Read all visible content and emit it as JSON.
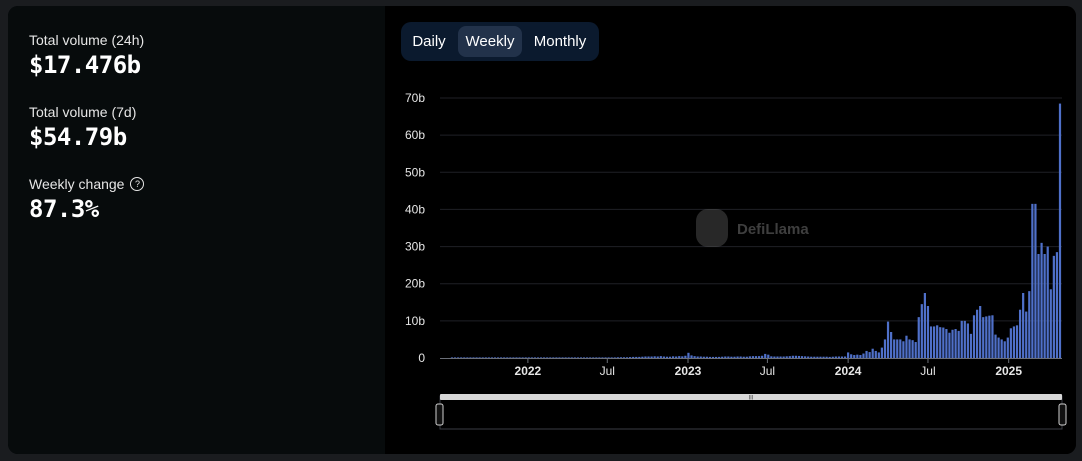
{
  "stats": {
    "total_24h": {
      "label": "Total volume (24h)",
      "value": "$17.476b"
    },
    "total_7d": {
      "label": "Total volume (7d)",
      "value": "$54.79b"
    },
    "weekly_change": {
      "label": "Weekly change",
      "value": "87.3%",
      "icon": "question-circle-icon"
    }
  },
  "tabs": [
    {
      "label": "Daily",
      "active": false
    },
    {
      "label": "Weekly",
      "active": true
    },
    {
      "label": "Monthly",
      "active": false
    }
  ],
  "watermark": "DefiLlama",
  "colors": {
    "bar": "#4f70c9",
    "grid": "#1f2126",
    "panel_left": "#070b0c",
    "tab_bg": "#0b1a2e",
    "tab_active": "#22324a"
  },
  "chart_data": {
    "type": "bar",
    "title": "",
    "xlabel": "",
    "ylabel": "",
    "ylim": [
      0,
      70
    ],
    "y_ticks": [
      "0",
      "10b",
      "20b",
      "30b",
      "40b",
      "50b",
      "60b",
      "70b"
    ],
    "y_unit": "billion USD",
    "x_tick_labels": [
      "2022",
      "Jul",
      "2023",
      "Jul",
      "2024",
      "Jul",
      "2025"
    ],
    "x_tick_positions": [
      "2022-01",
      "2022-07",
      "2023-01",
      "2023-07",
      "2024-01",
      "2024-07",
      "2025-01"
    ],
    "x_range": [
      "2021-07",
      "2025-01"
    ],
    "week_start": "2021-07-12",
    "series": [
      {
        "values": [
          0.05,
          0.05,
          0.05,
          0.05,
          0.05,
          0.05,
          0.05,
          0.05,
          0.05,
          0.05,
          0.05,
          0.05,
          0.05,
          0.05,
          0.05,
          0.05,
          0.05,
          0.05,
          0.05,
          0.05,
          0.05,
          0.05,
          0.05,
          0.05,
          0.05,
          0.05,
          0.05,
          0.05,
          0.05,
          0.05,
          0.05,
          0.05,
          0.05,
          0.05,
          0.05,
          0.05,
          0.05,
          0.05,
          0.05,
          0.05,
          0.05,
          0.05,
          0.05,
          0.05,
          0.05,
          0.1,
          0.1,
          0.05,
          0.1,
          0.1,
          0.1,
          0.1,
          0.15,
          0.15,
          0.2,
          0.2,
          0.2,
          0.2,
          0.25,
          0.3,
          0.3,
          0.3,
          0.35,
          0.4,
          0.4,
          0.4,
          0.45,
          0.4,
          0.5,
          0.4,
          0.35,
          0.35,
          0.45,
          0.4,
          0.5,
          0.45,
          0.6,
          1.4,
          0.7,
          0.5,
          0.4,
          0.4,
          0.35,
          0.35,
          0.3,
          0.3,
          0.3,
          0.3,
          0.35,
          0.4,
          0.4,
          0.35,
          0.35,
          0.4,
          0.4,
          0.35,
          0.35,
          0.45,
          0.5,
          0.5,
          0.5,
          0.6,
          1.1,
          0.9,
          0.45,
          0.4,
          0.4,
          0.4,
          0.4,
          0.45,
          0.5,
          0.6,
          0.6,
          0.55,
          0.5,
          0.45,
          0.4,
          0.35,
          0.35,
          0.35,
          0.35,
          0.35,
          0.35,
          0.3,
          0.35,
          0.4,
          0.4,
          0.4,
          0.4,
          1.5,
          1.0,
          0.8,
          0.9,
          0.8,
          1.2,
          1.9,
          1.6,
          2.5,
          1.9,
          1.5,
          2.8,
          5.0,
          9.8,
          7.0,
          5.0,
          5.0,
          5.0,
          4.5,
          6.0,
          5.0,
          4.8,
          4.3,
          11.0,
          14.5,
          17.5,
          14.0,
          8.5,
          8.5,
          8.8,
          8.3,
          8.2,
          7.8,
          6.8,
          7.6,
          7.8,
          7.3,
          10.0,
          10.0,
          9.3,
          6.5,
          11.5,
          13.0,
          14.0,
          11.0,
          11.2,
          11.4,
          11.5,
          6.3,
          5.5,
          5.0,
          4.5,
          5.5,
          8.0,
          8.5,
          8.8,
          13.0,
          17.5,
          12.5,
          18.0,
          41.5,
          41.5,
          28.0,
          31.0,
          28.0,
          30.0,
          18.5,
          27.5,
          28.5,
          68.5
        ]
      }
    ]
  },
  "range_slider": {
    "handle_glyph": "III"
  }
}
